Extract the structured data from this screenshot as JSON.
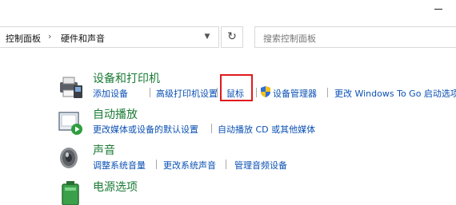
{
  "address": {
    "crumbs": [
      "控制面板",
      "硬件和声音"
    ],
    "separator": "›",
    "dropdown_icon": "chevron-down-icon",
    "refresh_glyph": "↻"
  },
  "search": {
    "placeholder": "搜索控制面板"
  },
  "categories": [
    {
      "title": "设备和打印机",
      "icon": "printer-icon",
      "links": [
        "添加设备",
        "高级打印机设置",
        "鼠标",
        "设备管理器",
        "更改 Windows To Go 启动选项"
      ]
    },
    {
      "title": "自动播放",
      "icon": "autoplay-icon",
      "links": [
        "更改媒体或设备的默认设置",
        "自动播放 CD 或其他媒体"
      ]
    },
    {
      "title": "声音",
      "icon": "speaker-icon",
      "links": [
        "调整系统音量",
        "更改系统声音",
        "管理音频设备"
      ]
    },
    {
      "title": "电源选项",
      "icon": "battery-icon",
      "links": []
    }
  ],
  "highlight_color": "#e0191e",
  "link_color": "#0a50b4",
  "title_color": "#1a7a34"
}
